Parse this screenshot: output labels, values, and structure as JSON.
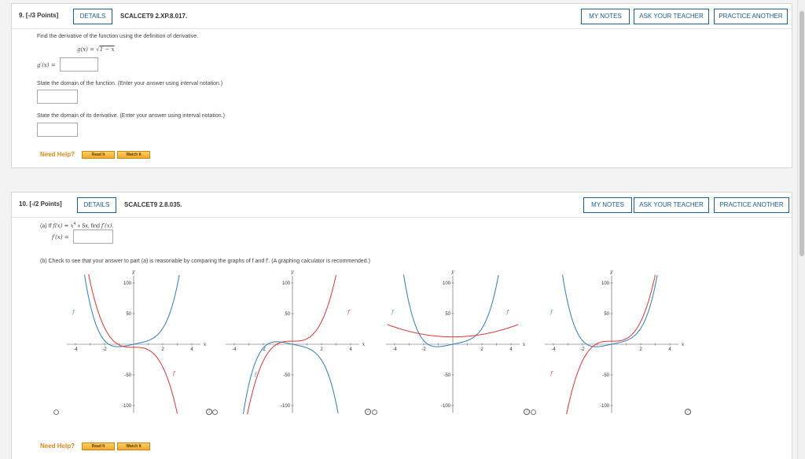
{
  "colors": {
    "accent": "#1a5fa0",
    "help_orange": "#e08a1e",
    "curve_red": "#e0352f",
    "curve_blue": "#2d7dbe"
  },
  "q9": {
    "number": "9.  [-/3 Points]",
    "details_label": "DETAILS",
    "code": "SCALCET9 2.XP.8.017.",
    "buttons": {
      "my_notes": "MY NOTES",
      "ask_teacher": "ASK YOUR TEACHER",
      "practice": "PRACTICE ANOTHER"
    },
    "instruction": "Find the derivative of the function using the definition of derivative.",
    "function_lhs": "g(x)  =  ",
    "function_rhs": "1 − x",
    "deriv_label": "g′(x)  =",
    "domain_prompt": "State the domain of the function. (Enter your answer using interval notation.)",
    "deriv_domain_prompt": "State the domain of its derivative. (Enter your answer using interval notation.)",
    "need_help": "Need Help?",
    "read_it": "Read It",
    "watch_it": "Watch It"
  },
  "q10": {
    "number": "10.  [-/2 Points]",
    "details_label": "DETAILS",
    "code": "SCALCET9 2.8.035.",
    "buttons": {
      "my_notes": "MY NOTES",
      "ask_teacher": "ASK YOUR TEACHER",
      "practice": "PRACTICE ANOTHER"
    },
    "part_a_prefix": "(a)   If ",
    "part_a_fx": "f(x)  =  x",
    "part_a_exp": "4",
    "part_a_rest": " + 5x,  find ",
    "part_a_fpx": "f′(x).",
    "deriv_label": "f′(x)  =",
    "part_b": "(b)   Check to see that your answer to part (a) is reasonable by comparing the graphs of f and f′. (A graphing calculator is recommended.)",
    "need_help": "Need Help?",
    "read_it": "Read It",
    "watch_it": "Watch It",
    "info_glyph": "i"
  },
  "chart_data": [
    {
      "type": "line",
      "x_range": [
        -4.5,
        4.5
      ],
      "ylim": [
        -115,
        115
      ],
      "xticks": [
        "-4",
        "-2",
        "2",
        "4"
      ],
      "yticks": [
        "100",
        "50",
        "-50",
        "-100"
      ],
      "xlabel": "x",
      "ylabel": "y",
      "curve_labels": [
        "f",
        "f′"
      ],
      "series": [
        {
          "name": "f",
          "expr": "x^4 + 5x",
          "color": "#2d7dbe"
        },
        {
          "name": "f′",
          "expr": "-(4x^3 + 5)",
          "color": "#e0352f"
        }
      ]
    },
    {
      "type": "line",
      "x_range": [
        -4.5,
        4.5
      ],
      "ylim": [
        -115,
        115
      ],
      "xticks": [
        "-4",
        "-2",
        "2",
        "4"
      ],
      "yticks": [
        "100",
        "50",
        "-50",
        "-100"
      ],
      "xlabel": "x",
      "ylabel": "y",
      "curve_labels": [
        "f",
        "f′"
      ],
      "series": [
        {
          "name": "f",
          "expr": "-(x^4 + 5x)",
          "color": "#2d7dbe"
        },
        {
          "name": "f′",
          "expr": "4x^3 + 5",
          "color": "#e0352f"
        }
      ]
    },
    {
      "type": "line",
      "x_range": [
        -4.5,
        4.5
      ],
      "ylim": [
        -115,
        115
      ],
      "xticks": [
        "-4",
        "-2",
        "2",
        "4"
      ],
      "yticks": [
        "100",
        "50",
        "-50",
        "-100"
      ],
      "xlabel": "x",
      "ylabel": "y",
      "curve_labels": [
        "f",
        "f′"
      ],
      "series": [
        {
          "name": "f",
          "expr": "x^4 + 5x",
          "color": "#2d7dbe"
        },
        {
          "name": "f′",
          "expr": "x^2 + 12",
          "color": "#e0352f"
        }
      ]
    },
    {
      "type": "line",
      "x_range": [
        -4.5,
        4.5
      ],
      "ylim": [
        -115,
        115
      ],
      "xticks": [
        "-4",
        "-2",
        "2",
        "4"
      ],
      "yticks": [
        "100",
        "50",
        "-50",
        "-100"
      ],
      "xlabel": "x",
      "ylabel": "y",
      "curve_labels": [
        "f",
        "f′"
      ],
      "series": [
        {
          "name": "f",
          "expr": "x^4 + 5x",
          "color": "#2d7dbe"
        },
        {
          "name": "f′",
          "expr": "4x^3 + 5",
          "color": "#e0352f"
        }
      ]
    }
  ]
}
